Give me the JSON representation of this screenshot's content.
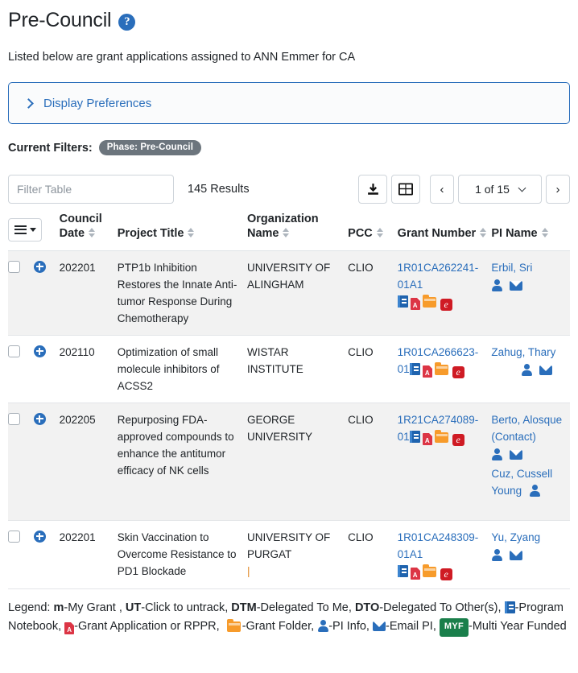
{
  "header": {
    "title": "Pre-Council",
    "help_icon": "question-circle-icon",
    "subtitle": "Listed below are grant applications assigned to ANN Emmer for CA"
  },
  "display_preferences": {
    "label": "Display Preferences",
    "chevron": "chevron-right-icon",
    "expanded": false,
    "border_color": "#2a6ebb"
  },
  "current_filters": {
    "label": "Current Filters:",
    "chips": [
      "Phase: Pre-Council"
    ],
    "chip_bg": "#6c757d"
  },
  "toolbar": {
    "filter_placeholder": "Filter Table",
    "filter_value": "",
    "results_count": "145 Results",
    "download_icon": "download-icon",
    "columns_icon": "grid-layout-icon",
    "prev_label": "‹",
    "next_label": "›",
    "page_indicator": "1 of 15",
    "page_chevron": "chevron-down-icon"
  },
  "table": {
    "menu_button": "column-menu-icon",
    "columns": [
      {
        "label": "Council Date",
        "sortable": true
      },
      {
        "label": "Project Title",
        "sortable": true
      },
      {
        "label": "Organization Name",
        "sortable": true
      },
      {
        "label": "PCC",
        "sortable": true
      },
      {
        "label": "Grant Number",
        "sortable": true
      },
      {
        "label": "PI Name",
        "sortable": true
      }
    ],
    "rows": [
      {
        "shaded": true,
        "council_date": "202201",
        "project_title": "PTP1b Inhibition Restores the Innate Anti-tumor Response During Chemotherapy",
        "organization_name": "UNIVERSITY OF ALINGHAM",
        "pcc": "CLIO",
        "grant_number": "1R01CA262241-01A1",
        "grant_icons": [
          "program-notebook-icon",
          "pdf-icon",
          "folder-icon",
          "e-icon"
        ],
        "pis": [
          {
            "name": "Erbil, Sri",
            "icons": [
              "pi-info-icon",
              "email-pi-icon"
            ]
          }
        ]
      },
      {
        "shaded": false,
        "council_date": "202110",
        "project_title": "Optimization of small molecule inhibitors of ACSS2",
        "organization_name": "WISTAR INSTITUTE",
        "pcc": "CLIO",
        "grant_number": "1R01CA266623-01",
        "grant_icons": [
          "program-notebook-icon",
          "pdf-icon",
          "folder-icon",
          "e-icon"
        ],
        "pis": [
          {
            "name": "Zahug, Thary",
            "icons": [
              "pi-info-icon",
              "email-pi-icon"
            ]
          }
        ]
      },
      {
        "shaded": true,
        "council_date": "202205",
        "project_title": "Repurposing FDA-approved compounds to enhance the antitumor efficacy of NK cells",
        "organization_name": "GEORGE UNIVERSITY",
        "pcc": "CLIO",
        "grant_number": "1R21CA274089-01",
        "grant_icons": [
          "program-notebook-icon",
          "pdf-icon",
          "folder-icon",
          "e-icon"
        ],
        "pis": [
          {
            "name": "Berto, Alosque (Contact)",
            "icons": [
              "pi-info-icon",
              "email-pi-icon"
            ]
          },
          {
            "name": "Cuz, Cussell Young",
            "icons": [
              "pi-info-icon"
            ]
          }
        ]
      },
      {
        "shaded": false,
        "council_date": "202201",
        "project_title": "Skin Vaccination to Overcome Resistance to PD1 Blockade",
        "organization_name": "UNIVERSITY OF PURGAT",
        "organization_marker": "|",
        "pcc": "CLIO",
        "grant_number": "1R01CA248309-01A1",
        "grant_icons": [
          "program-notebook-icon",
          "pdf-icon",
          "folder-icon",
          "e-icon"
        ],
        "pis": [
          {
            "name": "Yu, Zyang",
            "icons": [
              "pi-info-icon",
              "email-pi-icon"
            ]
          }
        ]
      }
    ]
  },
  "legend": {
    "prefix": "Legend:",
    "items": [
      {
        "abbr": "m",
        "text": "-My Grant ,"
      },
      {
        "abbr": "UT",
        "text": "-Click to untrack,"
      },
      {
        "abbr": "DTM",
        "text": "-Delegated To Me,"
      },
      {
        "abbr": "DTO",
        "text": "-Delegated To Other(s),"
      }
    ],
    "icon_items": [
      {
        "icon": "program-notebook-icon",
        "text": "-Program Notebook,"
      },
      {
        "icon": "pdf-icon",
        "text": "-Grant Application or RPPR,"
      },
      {
        "icon": "folder-icon",
        "text": "-Grant Folder,"
      },
      {
        "icon": "pi-info-icon",
        "text": "-PI Info,"
      },
      {
        "icon": "email-pi-icon",
        "text": "-Email PI,"
      }
    ],
    "myf_badge": "MYF",
    "myf_text": "-Multi Year Funded",
    "myf_color": "#1a7f4b"
  }
}
